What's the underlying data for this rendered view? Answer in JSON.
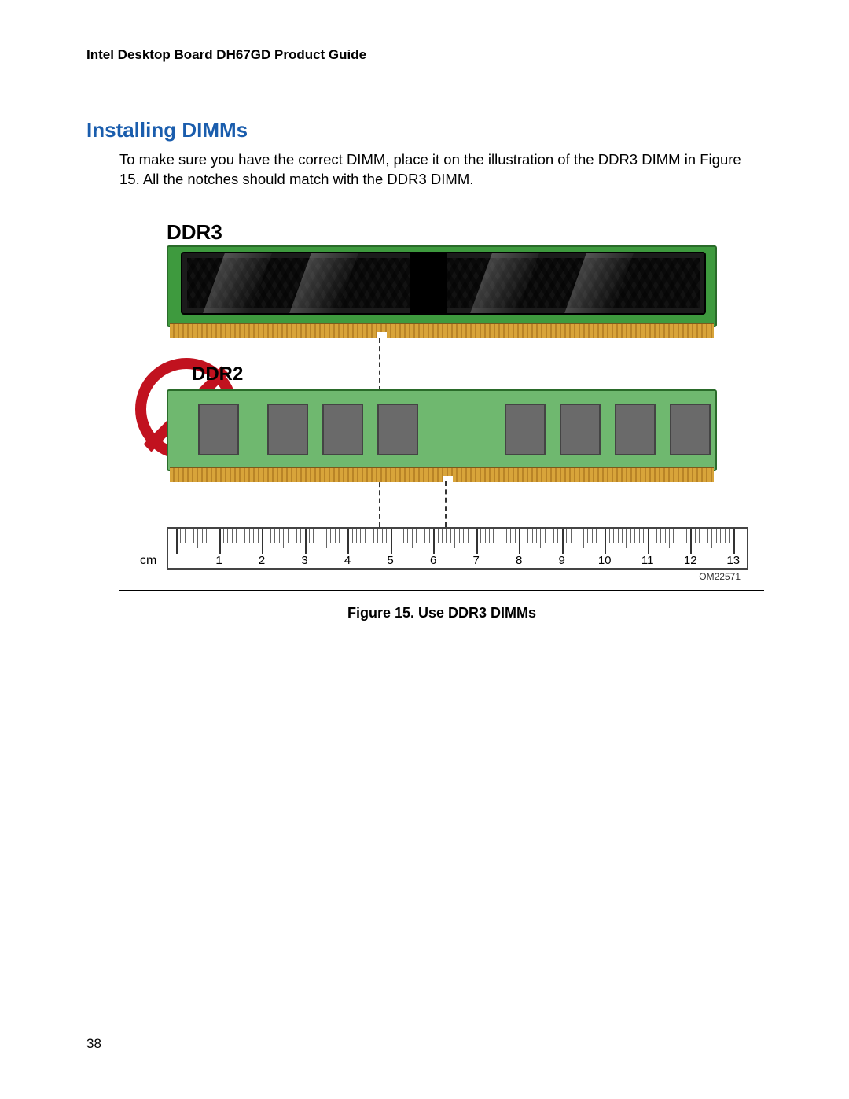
{
  "header": "Intel Desktop Board DH67GD Product Guide",
  "section_title": "Installing DIMMs",
  "paragraph": "To make sure you have the correct DIMM, place it on the illustration of the DDR3 DIMM in Figure 15.  All the notches should match with the DDR3 DIMM.",
  "figure": {
    "label_ddr3": "DDR3",
    "label_ddr2": "DDR2",
    "ruler_unit": "cm",
    "ruler_max": 13,
    "om_code": "OM22571",
    "caption": "Figure 15.  Use DDR3 DIMMs"
  },
  "page_number": "38"
}
